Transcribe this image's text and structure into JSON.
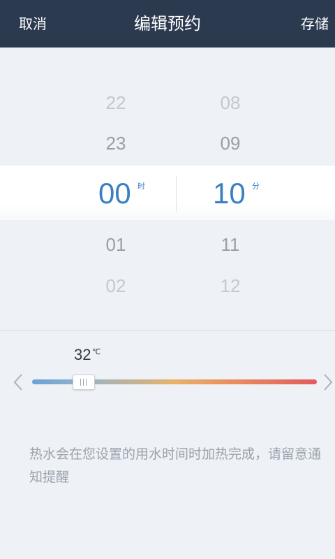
{
  "header": {
    "cancel_label": "取消",
    "title": "编辑预约",
    "save_label": "存储",
    "background_color": "#2c3a50"
  },
  "time_picker": {
    "hours": {
      "above": [
        "22",
        "23"
      ],
      "selected": "00",
      "below": [
        "01",
        "02"
      ],
      "unit": "时"
    },
    "minutes": {
      "above": [
        "08",
        "09"
      ],
      "selected": "10",
      "below": [
        "11",
        "12"
      ],
      "unit": "分"
    },
    "accent_color": "#3a7fc4"
  },
  "temperature": {
    "value": "32",
    "unit": "℃",
    "prev_icon": "chevron-left-icon",
    "next_icon": "chevron-right-icon",
    "slider_fraction": 0.18,
    "gradient_colors": [
      "#6aa3d8",
      "#e9b26a",
      "#e35a5e"
    ]
  },
  "notice": "热水会在您设置的用水时间时加热完成，请留意通知提醒"
}
